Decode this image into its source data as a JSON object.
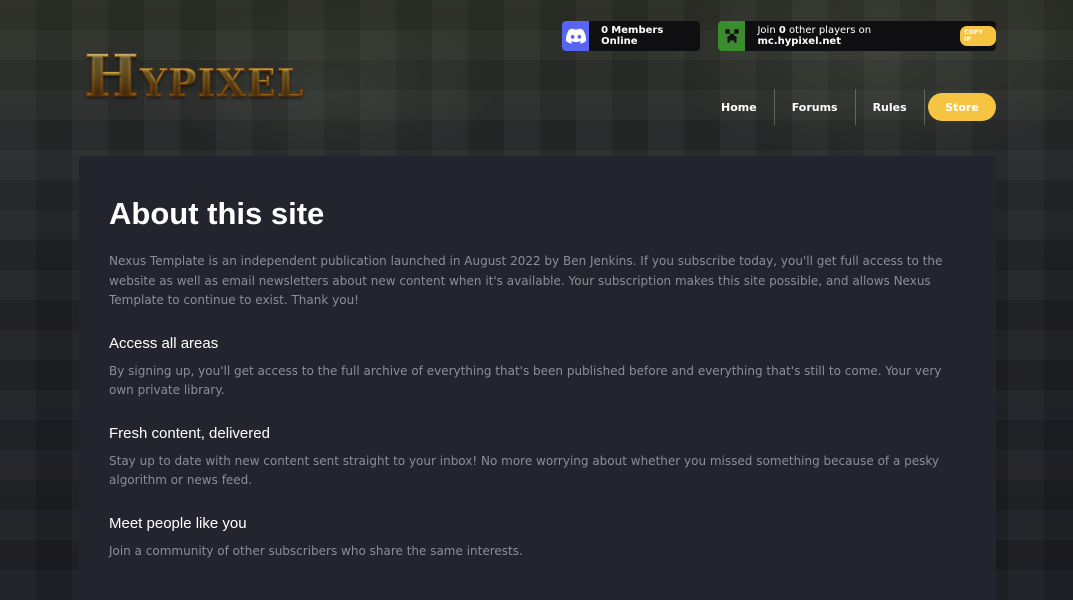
{
  "logo": {
    "text_first": "H",
    "text_rest": "YPIXEL"
  },
  "discord": {
    "count": "0",
    "label": "Members Online"
  },
  "players": {
    "prefix": "Join",
    "count": "0",
    "middle": "other players on",
    "server": "mc.hypixel.net",
    "copy_label": "COPY IP"
  },
  "nav": {
    "home": "Home",
    "forums": "Forums",
    "rules": "Rules",
    "store": "Store"
  },
  "content": {
    "title": "About this site",
    "intro": "Nexus Template is an independent publication launched in August 2022 by Ben Jenkins. If you subscribe today, you'll get full access to the website as well as email newsletters about new content when it's available. Your subscription makes this site possible, and allows Nexus Template to continue to exist. Thank you!",
    "sections": [
      {
        "heading": "Access all areas",
        "body": "By signing up, you'll get access to the full archive of everything that's been published before and everything that's still to come. Your very own private library."
      },
      {
        "heading": "Fresh content, delivered",
        "body": "Stay up to date with new content sent straight to your inbox! No more worrying about whether you missed something because of a pesky algorithm or news feed."
      },
      {
        "heading": "Meet people like you",
        "body": "Join a community of other subscribers who share the same interests."
      }
    ]
  },
  "icons": {
    "discord": "discord-icon",
    "creeper": "creeper-icon"
  },
  "colors": {
    "accent": "#f5c542",
    "discord": "#5865f2",
    "card": "#23242d",
    "body_text": "#8c8d96"
  }
}
